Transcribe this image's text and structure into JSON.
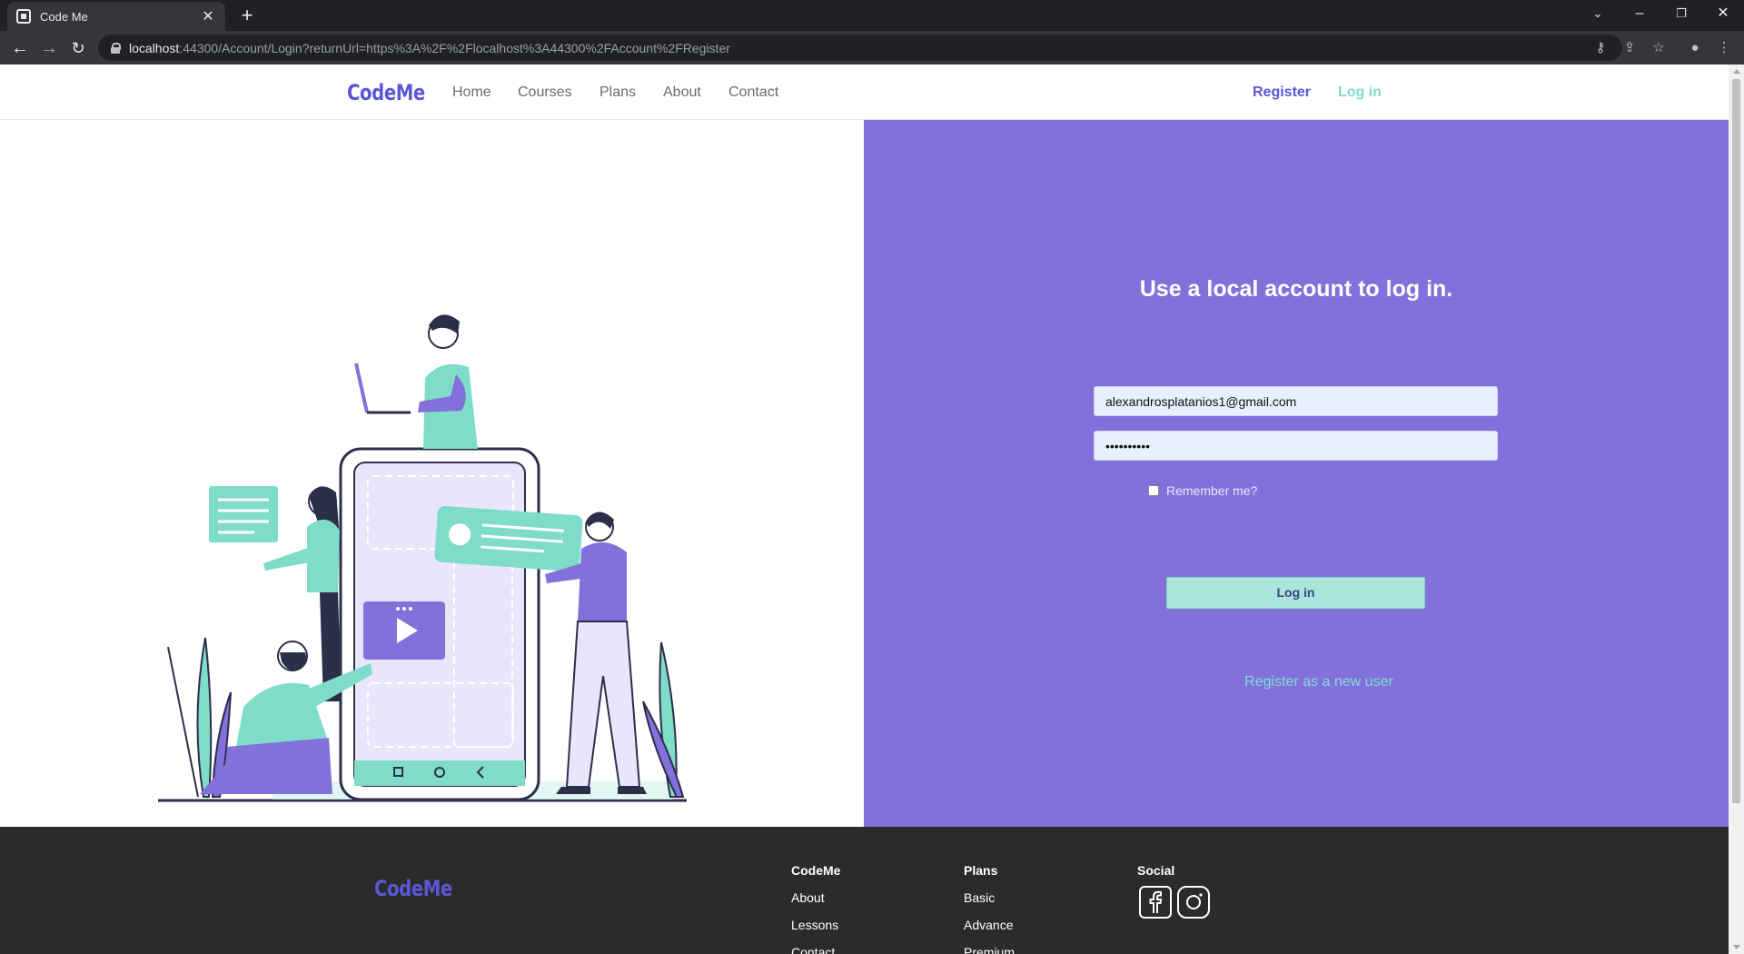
{
  "browser": {
    "tab_title": "Code Me",
    "url_host": "localhost",
    "url_rest": ":44300/Account/Login?returnUrl=https%3A%2F%2Flocalhost%3A44300%2FAccount%2FRegister"
  },
  "navbar": {
    "brand": "CodeMe",
    "links": [
      "Home",
      "Courses",
      "Plans",
      "About",
      "Contact"
    ],
    "register": "Register",
    "login": "Log in"
  },
  "login": {
    "title": "Use a local account to log in.",
    "email_value": "alexandrosplatanios1@gmail.com",
    "password_value": "••••••••••",
    "remember_label": "Remember me?",
    "submit_label": "Log in",
    "register_link": "Register as a new user"
  },
  "footer": {
    "brand": "CodeMe",
    "columns": [
      {
        "title": "CodeMe",
        "links": [
          "About",
          "Lessons",
          "Contact"
        ]
      },
      {
        "title": "Plans",
        "links": [
          "Basic",
          "Advance",
          "Premium"
        ]
      },
      {
        "title": "Social",
        "links": []
      }
    ]
  },
  "colors": {
    "accent_purple": "#8370db",
    "brand_blue": "#5b57d6",
    "teal": "#7fdcc8",
    "footer_bg": "#2b2b2b"
  },
  "icons": [
    "facebook-icon",
    "instagram-icon"
  ]
}
